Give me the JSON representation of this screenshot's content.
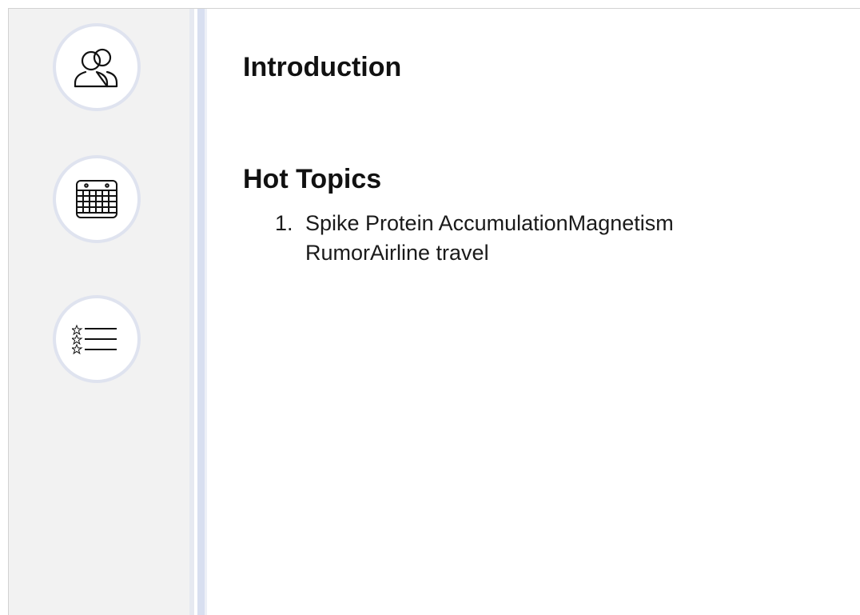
{
  "sidebar": {
    "items": [
      {
        "icon": "users-icon"
      },
      {
        "icon": "calendar-icon"
      },
      {
        "icon": "starred-list-icon"
      }
    ]
  },
  "main": {
    "intro_heading": "Introduction",
    "topics_heading": "Hot Topics",
    "topics": [
      {
        "number": "1.",
        "text": "Spike Protein AccumulationMagnetism RumorAirline travel"
      }
    ]
  },
  "colors": {
    "sidebar_bg": "#f2f2f2",
    "circle_border": "#dfe3ef",
    "rail_accent": "#d8dff0",
    "text": "#111111"
  }
}
